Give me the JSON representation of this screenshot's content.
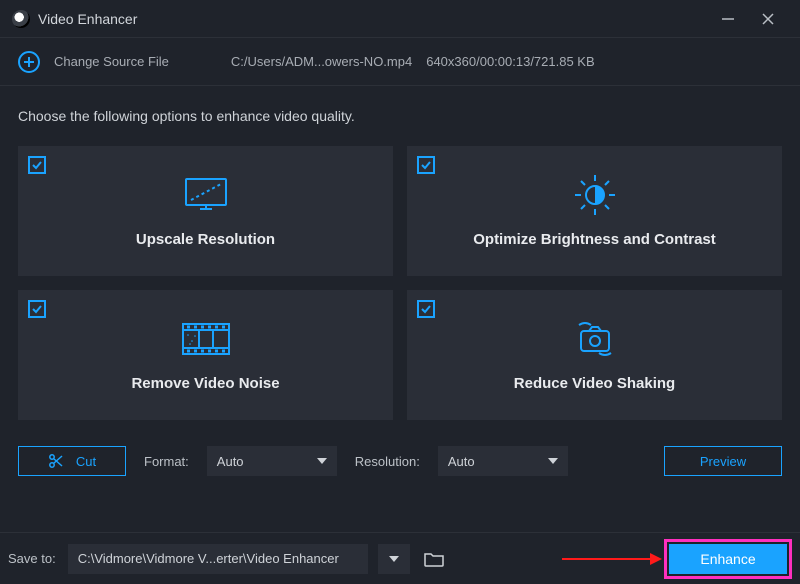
{
  "titlebar": {
    "app_title": "Video Enhancer"
  },
  "source": {
    "change_label": "Change Source File",
    "file_path": "C:/Users/ADM...owers-NO.mp4",
    "file_info": "640x360/00:00:13/721.85 KB"
  },
  "prompt": "Choose the following options to enhance video quality.",
  "cards": [
    {
      "title": "Upscale Resolution"
    },
    {
      "title": "Optimize Brightness and Contrast"
    },
    {
      "title": "Remove Video Noise"
    },
    {
      "title": "Reduce Video Shaking"
    }
  ],
  "controls": {
    "cut_label": "Cut",
    "format_label": "Format:",
    "format_value": "Auto",
    "resolution_label": "Resolution:",
    "resolution_value": "Auto",
    "preview_label": "Preview"
  },
  "footer": {
    "save_label": "Save to:",
    "save_path": "C:\\Vidmore\\Vidmore V...erter\\Video Enhancer",
    "enhance_label": "Enhance"
  }
}
